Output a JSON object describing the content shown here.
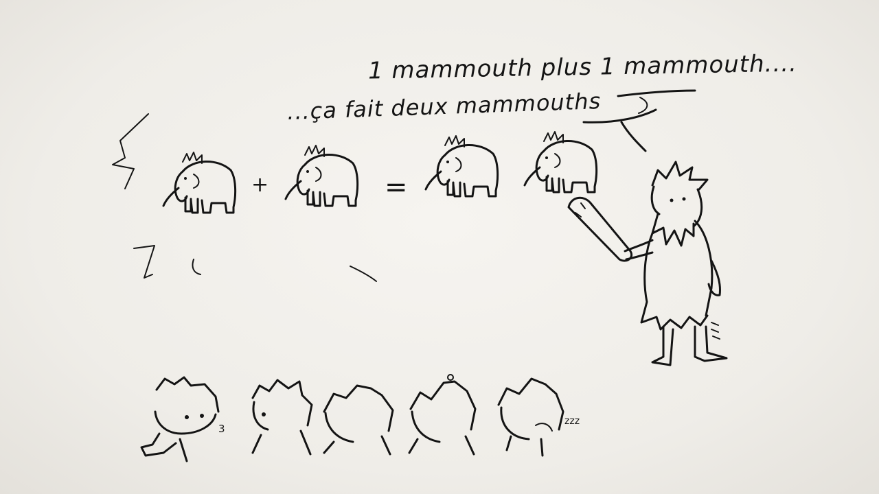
{
  "speech": {
    "line1": "1 mammouth plus 1 mammouth....",
    "line2": "...ça fait deux mammouths"
  },
  "equation": {
    "plus": "+",
    "equals": "=",
    "left_count": 1,
    "right_count": 1,
    "result_count": 2
  },
  "students": {
    "count": 5,
    "snore": "zzz",
    "whistle": "3"
  },
  "colors": {
    "ink": "#141414",
    "paper": "#f1efea"
  }
}
